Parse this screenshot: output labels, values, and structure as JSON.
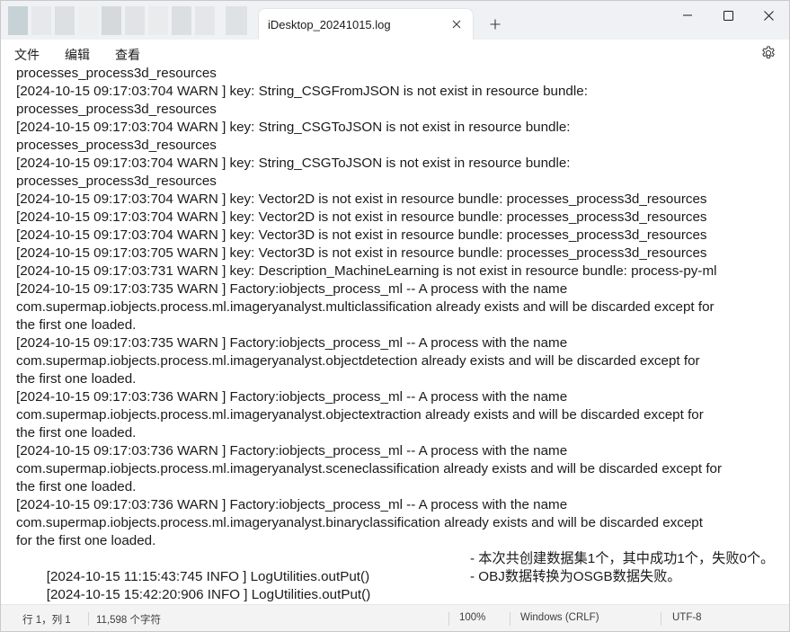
{
  "window": {
    "tab_title": "iDesktop_20241015.log",
    "controls": {
      "minimize": "minimize",
      "maximize": "maximize",
      "close": "close"
    }
  },
  "menu": {
    "file": "文件",
    "edit": "编辑",
    "view": "查看"
  },
  "editor": {
    "lines": [
      "processes_process3d_resources",
      "[2024-10-15 09:17:03:704 WARN ] key: String_CSGFromJSON is not exist in resource bundle:",
      "processes_process3d_resources",
      "[2024-10-15 09:17:03:704 WARN ] key: String_CSGToJSON is not exist in resource bundle:",
      "processes_process3d_resources",
      "[2024-10-15 09:17:03:704 WARN ] key: String_CSGToJSON is not exist in resource bundle:",
      "processes_process3d_resources",
      "[2024-10-15 09:17:03:704 WARN ] key: Vector2D is not exist in resource bundle: processes_process3d_resources",
      "[2024-10-15 09:17:03:704 WARN ] key: Vector2D is not exist in resource bundle: processes_process3d_resources",
      "[2024-10-15 09:17:03:704 WARN ] key: Vector3D is not exist in resource bundle: processes_process3d_resources",
      "[2024-10-15 09:17:03:705 WARN ] key: Vector3D is not exist in resource bundle: processes_process3d_resources",
      "[2024-10-15 09:17:03:731 WARN ] key: Description_MachineLearning is not exist in resource bundle: process-py-ml",
      "[2024-10-15 09:17:03:735 WARN ] Factory:iobjects_process_ml -- A process with the name",
      "com.supermap.iobjects.process.ml.imageryanalyst.multiclassification already exists and will be discarded except for",
      "the first one loaded.",
      "[2024-10-15 09:17:03:735 WARN ] Factory:iobjects_process_ml -- A process with the name",
      "com.supermap.iobjects.process.ml.imageryanalyst.objectdetection already exists and will be discarded except for",
      "the first one loaded.",
      "[2024-10-15 09:17:03:736 WARN ] Factory:iobjects_process_ml -- A process with the name",
      "com.supermap.iobjects.process.ml.imageryanalyst.objectextraction already exists and will be discarded except for",
      "the first one loaded.",
      "[2024-10-15 09:17:03:736 WARN ] Factory:iobjects_process_ml -- A process with the name",
      "com.supermap.iobjects.process.ml.imageryanalyst.sceneclassification already exists and will be discarded except for",
      "the first one loaded.",
      "[2024-10-15 09:17:03:736 WARN ] Factory:iobjects_process_ml -- A process with the name",
      "com.supermap.iobjects.process.ml.imageryanalyst.binaryclassification already exists and will be discarded except",
      "for the first one loaded."
    ],
    "info_lines": [
      {
        "prefix": "[2024-10-15 11:15:43:745 INFO ] LogUtilities.outPut()",
        "message": "- 本次共创建数据集1个，其中成功1个，失败0个。"
      },
      {
        "prefix": "[2024-10-15 15:42:20:906 INFO ] LogUtilities.outPut()",
        "message": "- OBJ数据转换为OSGB数据失败。"
      }
    ]
  },
  "status": {
    "position": "行 1，列 1",
    "char_count": "11,598 个字符",
    "zoom": "100%",
    "line_ending": "Windows (CRLF)",
    "encoding": "UTF-8"
  }
}
